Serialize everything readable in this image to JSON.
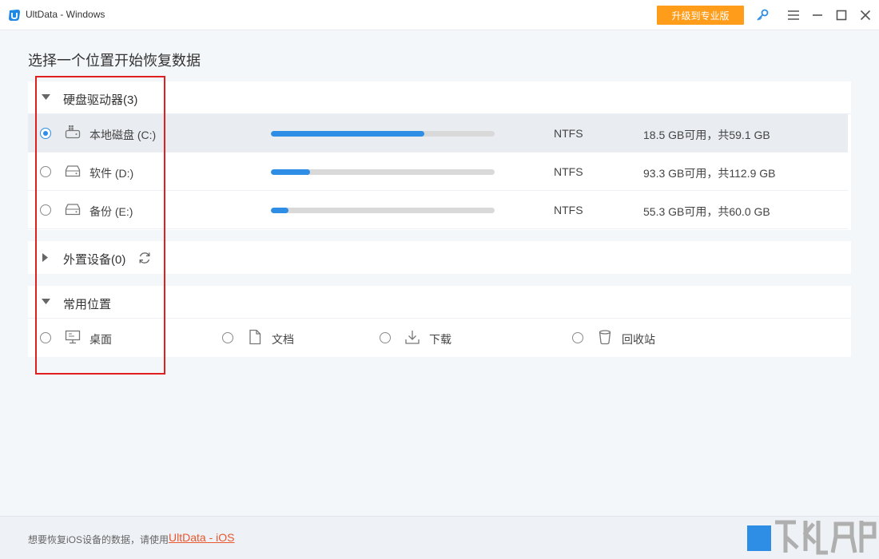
{
  "window": {
    "title": "UltData - Windows",
    "upgrade_label": "升级到专业版"
  },
  "page": {
    "title": "选择一个位置开始恢复数据"
  },
  "drives": {
    "header": "硬盘驱动器(3)",
    "items": [
      {
        "name": "本地磁盘 (C:)",
        "fs": "NTFS",
        "space": "18.5 GB可用，共59.1 GB",
        "used_fraction": 0.687,
        "selected": true
      },
      {
        "name": "软件 (D:)",
        "fs": "NTFS",
        "space": "93.3 GB可用，共112.9 GB",
        "used_fraction": 0.174,
        "selected": false
      },
      {
        "name": "备份 (E:)",
        "fs": "NTFS",
        "space": "55.3 GB可用，共60.0 GB",
        "used_fraction": 0.078,
        "selected": false
      }
    ]
  },
  "external": {
    "header": "外置设备(0)"
  },
  "common": {
    "header": "常用位置",
    "items": [
      {
        "label": "桌面",
        "icon": "monitor-icon"
      },
      {
        "label": "文档",
        "icon": "document-icon"
      },
      {
        "label": "下载",
        "icon": "download-icon"
      },
      {
        "label": "回收站",
        "icon": "recycle-bin-icon"
      }
    ]
  },
  "footer": {
    "text": "想要恢复iOS设备的数据，请使用",
    "link": "UltData - iOS"
  },
  "colors": {
    "accent": "#2e8de5",
    "upgrade": "#ff9d1a",
    "annotation": "#e0201f",
    "link": "#e8572d"
  }
}
